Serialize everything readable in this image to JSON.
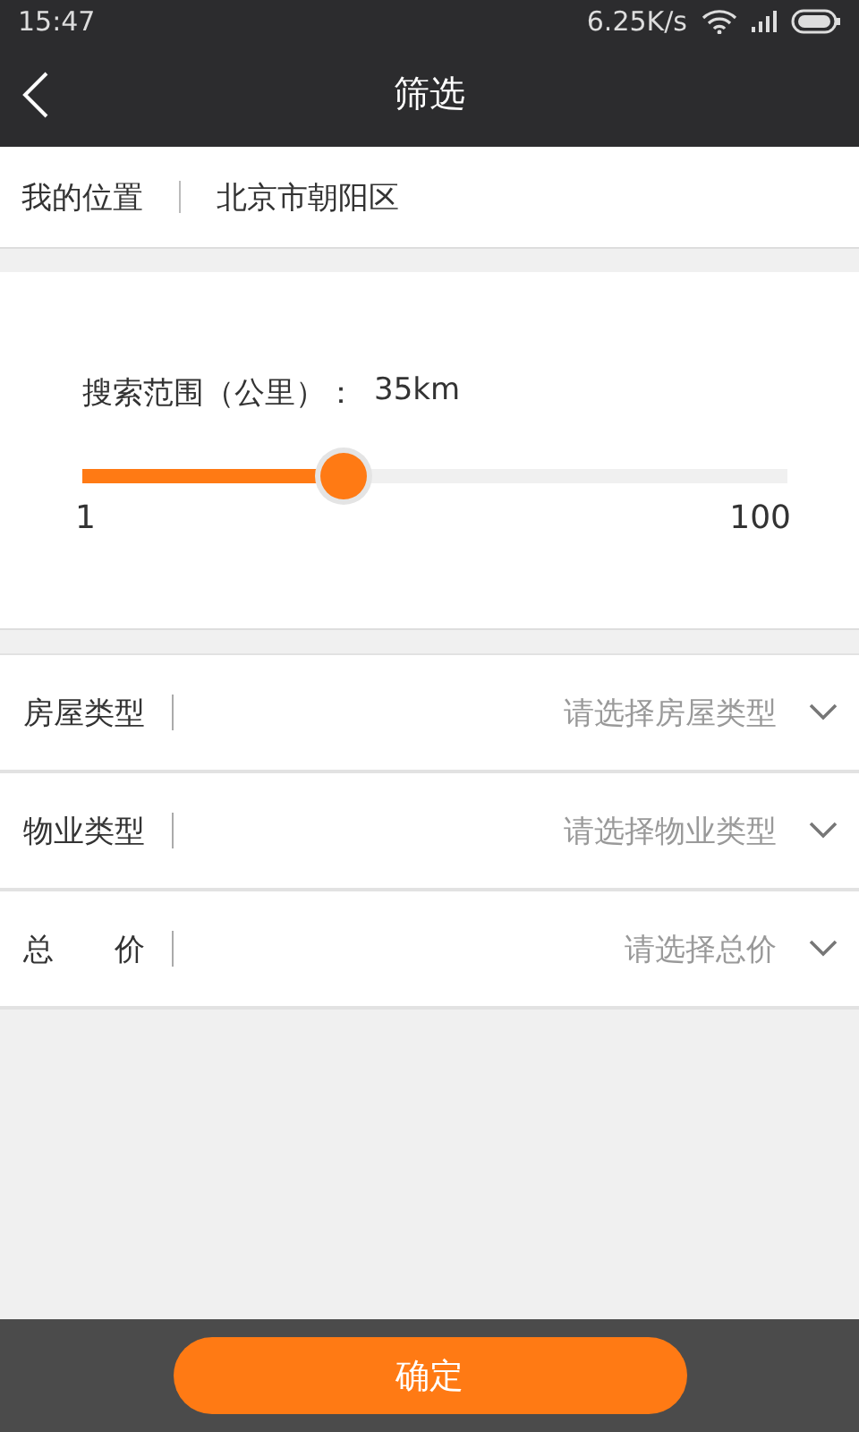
{
  "status_bar": {
    "time": "15:47",
    "speed": "6.25K/s"
  },
  "header": {
    "title": "筛选"
  },
  "location": {
    "label": "我的位置",
    "value": "北京市朝阳区"
  },
  "range": {
    "label": "搜索范围（公里）：",
    "value": "35km",
    "level": 0.37,
    "min": "1",
    "max": "100"
  },
  "filters": [
    {
      "label": "房屋类型",
      "placeholder": "请选择房屋类型"
    },
    {
      "label": "物业类型",
      "placeholder": "请选择物业类型"
    },
    {
      "label": "总　　价",
      "placeholder": "请选择总价"
    }
  ],
  "confirm_button": "确定"
}
